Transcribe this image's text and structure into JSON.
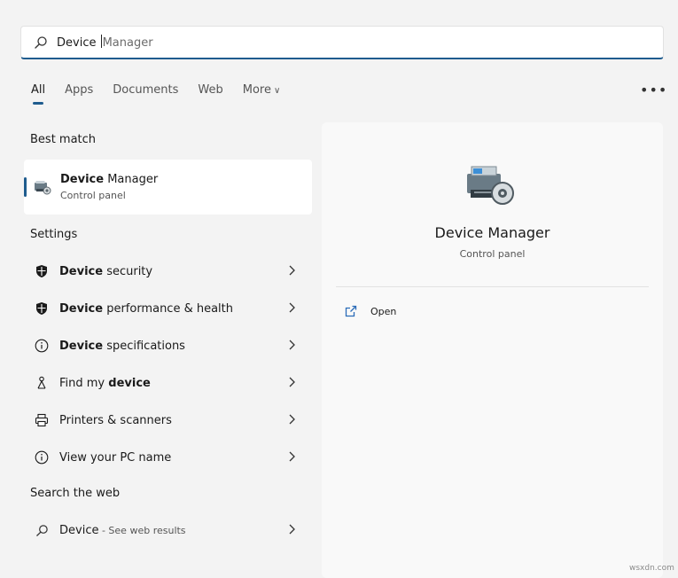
{
  "search": {
    "typed": "Device ",
    "suggestion": "Manager"
  },
  "tabs": [
    {
      "label": "All"
    },
    {
      "label": "Apps"
    },
    {
      "label": "Documents"
    },
    {
      "label": "Web"
    },
    {
      "label": "More"
    }
  ],
  "more_options_label": "•••",
  "best_match": {
    "heading": "Best match",
    "name_bold": "Device",
    "name_rest": " Manager",
    "subtitle": "Control panel"
  },
  "settings": {
    "heading": "Settings",
    "items": [
      {
        "bold": "Device",
        "rest": " security",
        "icon": "shield-icon"
      },
      {
        "bold": "Device",
        "rest": " performance & health",
        "icon": "shield-icon"
      },
      {
        "bold": "Device",
        "rest": " specifications",
        "icon": "info-icon"
      },
      {
        "pre": "Find my ",
        "bold": "device",
        "icon": "person-location-icon"
      },
      {
        "pre": "Printers & scanners",
        "icon": "printer-icon"
      },
      {
        "pre": "View your PC name",
        "icon": "info-icon"
      }
    ]
  },
  "web": {
    "heading": "Search the web",
    "query": "Device",
    "suffix": " - See web results"
  },
  "detail": {
    "title": "Device Manager",
    "subtitle": "Control panel",
    "actions": [
      {
        "label": "Open",
        "icon": "open-external-icon"
      }
    ]
  },
  "watermark": "wsxdn.com",
  "colors": {
    "accent": "#1f5c8e",
    "open_icon": "#2b6cb8"
  }
}
